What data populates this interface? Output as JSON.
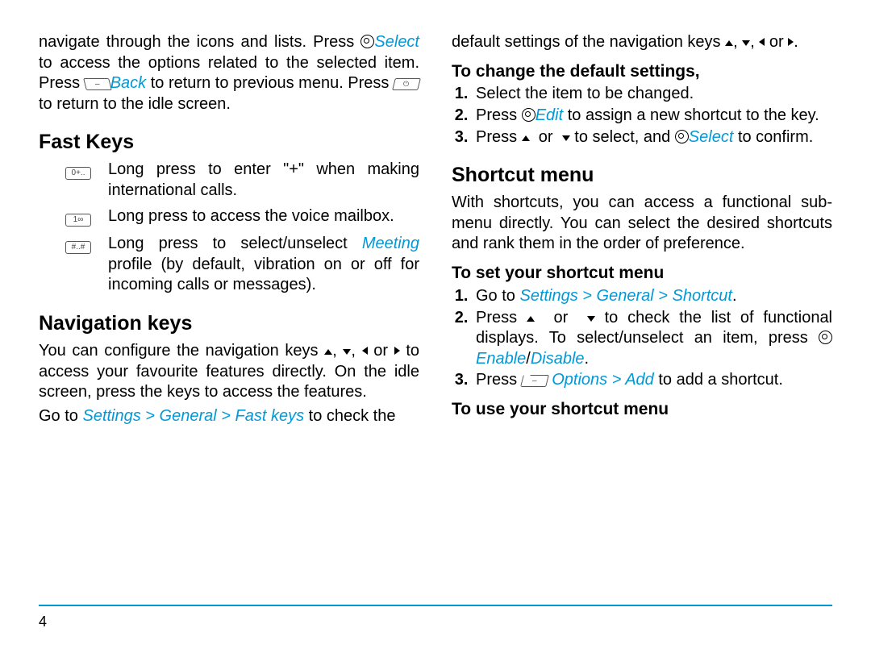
{
  "page_number": "4",
  "left": {
    "intro": {
      "t1": "navigate through the icons and lists. Press ",
      "select": "Select",
      "t2": " to access the options related to the selected item. Press ",
      "back": "Back",
      "t3": " to return to previous menu. Press ",
      "t4": " to return to the idle screen."
    },
    "h_fast": "Fast Keys",
    "fk0_key": "0+..",
    "fk0": "Long press to enter \"+\" when making international calls.",
    "fk1_key": "1∞",
    "fk1": "Long press to access the voice mailbox.",
    "fk2_key": "#..#",
    "fk2a": "Long press to select/unselect ",
    "fk2_meeting": "Meeting",
    "fk2b": " profile (by default, vibration on or off for incoming calls or messages).",
    "h_nav": "Navigation keys",
    "nav_p1a": "You can configure the navigation keys ",
    "nav_p1b": " to access your favourite features directly. On the idle screen, press the keys to access the features.",
    "nav_p2a": "Go to ",
    "nav_path": "Settings > General > Fast keys",
    "nav_p2b": " to check the "
  },
  "right": {
    "top": "default settings of the navigation keys ",
    "h_change": "To change the default settings,",
    "step1": "Select the item to be changed.",
    "step2a": "Press ",
    "edit": "Edit",
    "step2b": " to assign a new shortcut to the key.",
    "step3a": "Press ",
    "step3b": " to select, and ",
    "select": "Select",
    "step3c": " to confirm.",
    "h_shortcut": "Shortcut menu",
    "shortcut_p": "With shortcuts, you can access a functional sub-menu directly. You can select the desired shortcuts and rank them in the order of preference.",
    "h_set": "To set your shortcut menu",
    "set1a": "Go to ",
    "set1_path": "Settings > General > Shortcut",
    "set1b": ".",
    "set2a": "Press ",
    "set2b": " to check the list of functional displays. To select/unselect an item, press ",
    "enable": "Enable",
    "slash": "/",
    "disable": "Disable",
    "set2c": ".",
    "set3a": "Press ",
    "options_add": " Options > Add",
    "set3b": " to add a shortcut.",
    "h_use": "To use your shortcut menu"
  }
}
